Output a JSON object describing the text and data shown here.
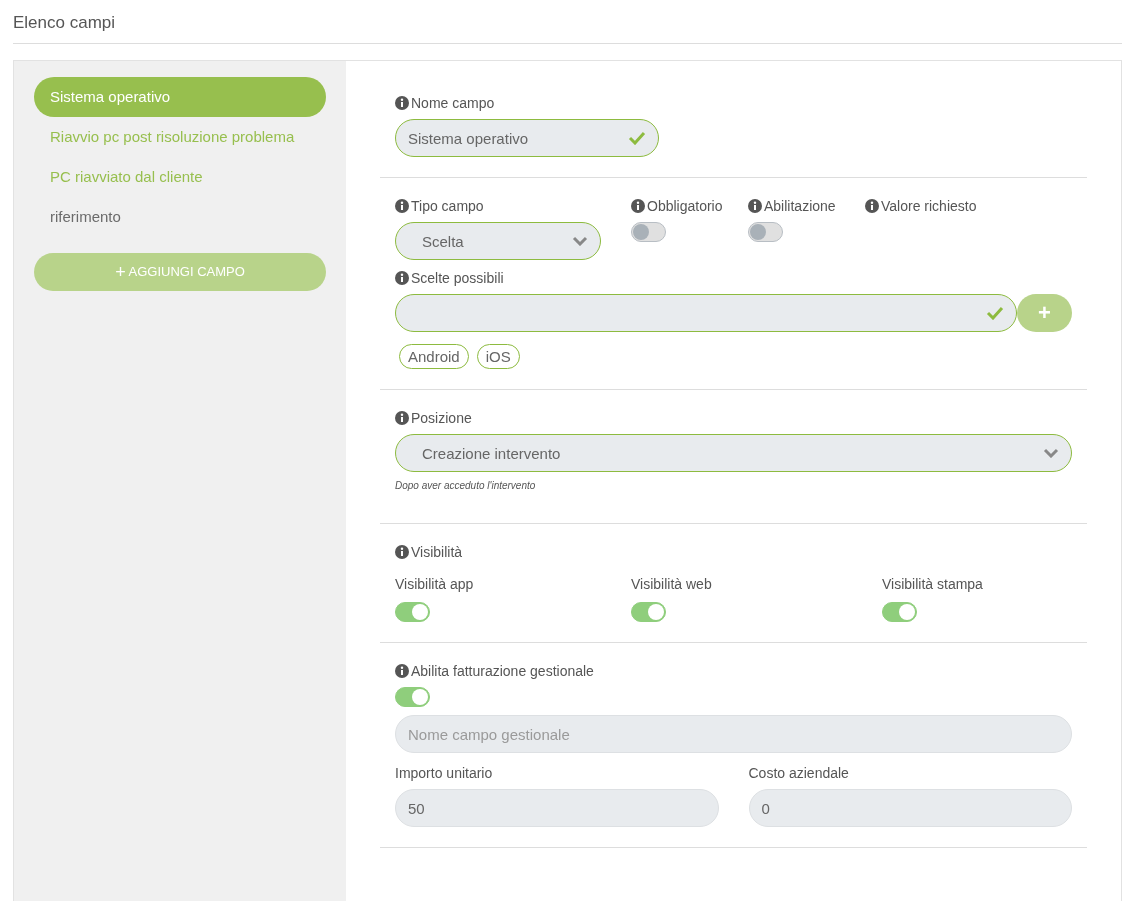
{
  "header": {
    "title": "Elenco campi"
  },
  "sidebar": {
    "items": [
      {
        "label": "Sistema operativo",
        "selected": true,
        "color": "#97bf4e"
      },
      {
        "label": "Riavvio pc post risoluzione problema",
        "selected": false,
        "color": "#97bf4e"
      },
      {
        "label": "PC riavviato dal cliente",
        "selected": false,
        "color": "#97bf4e"
      },
      {
        "label": "riferimento",
        "selected": false,
        "color": "#6b6b6b"
      }
    ],
    "add_button": {
      "icon": "+",
      "label": "AGGIUNGI CAMPO"
    }
  },
  "form": {
    "nome_campo": {
      "label": "Nome campo",
      "value": "Sistema operativo",
      "valid": true
    },
    "tipo_campo": {
      "label": "Tipo campo",
      "value": "Scelta"
    },
    "flags": [
      {
        "kind": "toggle",
        "label": "Obbligatorio",
        "on": false
      },
      {
        "kind": "toggle",
        "label": "Abilitazione",
        "on": false
      },
      {
        "kind": "label",
        "label": "Valore richiesto"
      }
    ],
    "scelte": {
      "label": "Scelte possibili",
      "valid": true,
      "add_button": "+",
      "tags": [
        "Android",
        "iOS"
      ]
    },
    "posizione": {
      "label": "Posizione",
      "value": "Creazione intervento",
      "hint": "Dopo aver acceduto l'intervento"
    },
    "visibilita": {
      "label": "Visibilità",
      "items": [
        {
          "label": "Visibilità app",
          "on": true
        },
        {
          "label": "Visibilità web",
          "on": true
        },
        {
          "label": "Visibilità stampa",
          "on": true
        }
      ]
    },
    "fatturazione": {
      "label": "Abilita fatturazione gestionale",
      "on": true,
      "field": {
        "placeholder": "Nome campo gestionale"
      },
      "amounts": [
        {
          "label": "Importo unitario",
          "value": "50"
        },
        {
          "label": "Costo aziendale",
          "value": "0"
        }
      ]
    }
  }
}
